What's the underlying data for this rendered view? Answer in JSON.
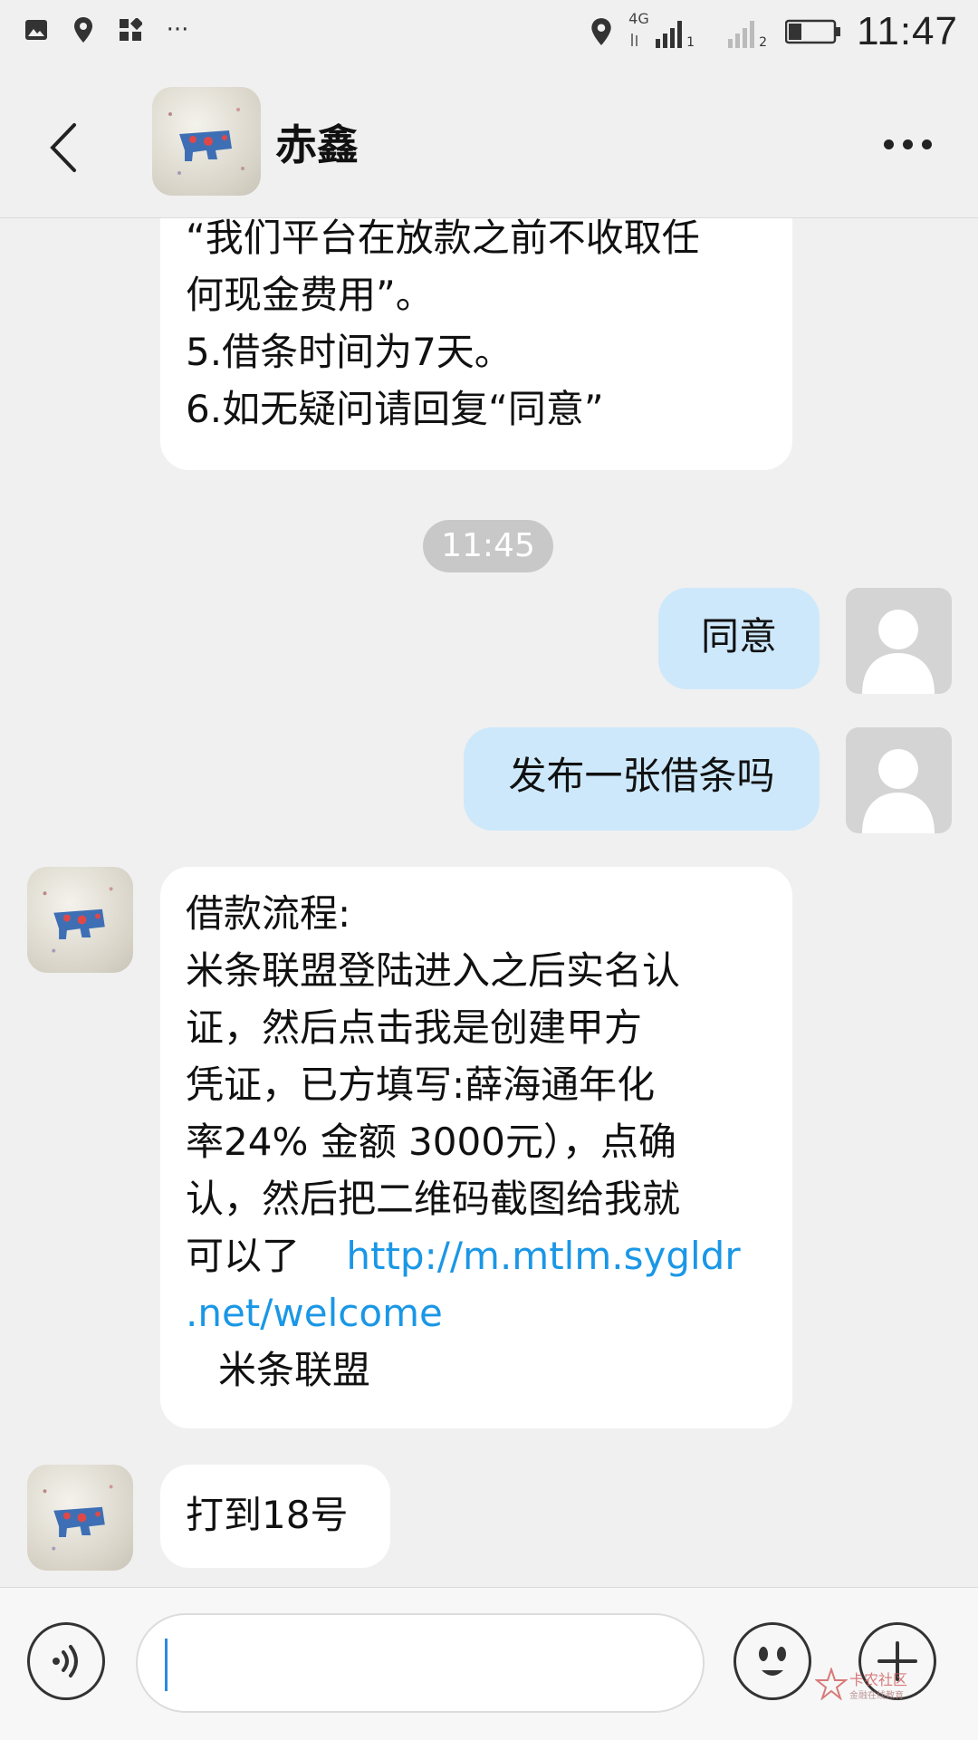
{
  "status_bar": {
    "time": "11:47",
    "network": "4G",
    "sim1": "1",
    "sim2": "2",
    "overflow": "···",
    "icons": [
      "image-icon",
      "location-icon",
      "app-grid-icon",
      "location-icon",
      "signal-icon",
      "battery-icon"
    ]
  },
  "header": {
    "contact_name": "赤鑫",
    "back_icon": "chevron-left-icon",
    "more_icon": "more-dots-icon"
  },
  "messages": {
    "m1": {
      "direction": "incoming",
      "lines": [
        "“我们平台在放款之前不收取任",
        "何现金费用”。",
        "5.借条时间为7天。",
        "6.如无疑问请回复“同意”"
      ]
    },
    "timestamp": "11:45",
    "m2": {
      "direction": "outgoing",
      "text": "同意"
    },
    "m3": {
      "direction": "outgoing",
      "text": "发布一张借条吗"
    },
    "m4": {
      "direction": "incoming",
      "lines": [
        "借款流程:",
        "米条联盟登陆进入之后实名认",
        "证，然后点击我是创建甲方",
        "凭证，已方填写:薛海通年化",
        "率24% 金额 3000元），点确",
        "认，然后把二维码截图给我就"
      ],
      "last_text": "可以了",
      "link_part1": "http://m.mtlm.sygldr",
      "link_part2": ".net/welcome",
      "footer": "米条联盟"
    },
    "m5": {
      "direction": "incoming",
      "text": "打到18号"
    }
  },
  "input_bar": {
    "input_value": "",
    "voice_icon": "voice-icon",
    "emoji_icon": "emoji-icon",
    "plus_icon": "plus-icon"
  },
  "watermark": {
    "title": "卡农社区",
    "subtitle": "金融在线教育"
  },
  "colors": {
    "background": "#f0f0f0",
    "incoming_bubble": "#ffffff",
    "outgoing_bubble": "#cde8fb",
    "link": "#1a97e6",
    "timestamp_pill": "#c8c8c8"
  }
}
